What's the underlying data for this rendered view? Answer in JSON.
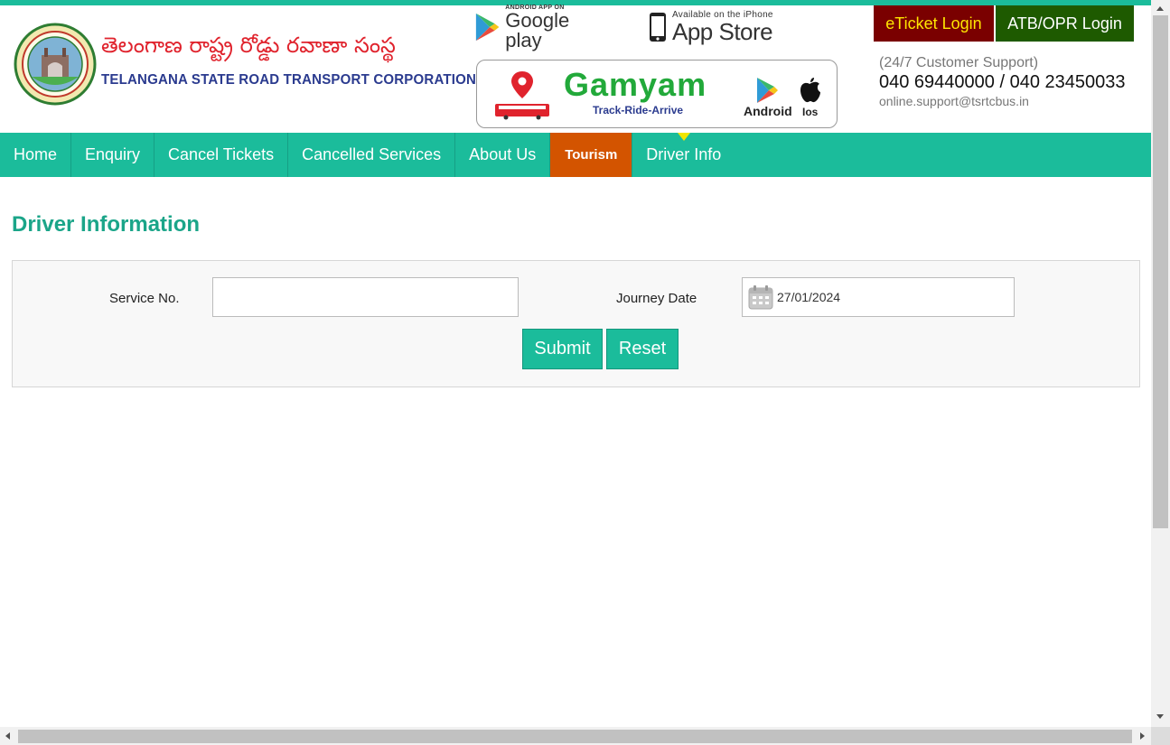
{
  "header": {
    "brand_telugu": "తెలంగాణ  రాష్ట్ర రోడ్డు రవాణా సంస్థ",
    "brand_english": "TELANGANA STATE ROAD TRANSPORT CORPORATION",
    "google_play": {
      "small": "ANDROID APP ON",
      "big": "Google play"
    },
    "app_store": {
      "small": "Available on the iPhone",
      "big": "App Store"
    },
    "gamyam": {
      "title": "Gamyam",
      "tagline": "Track-Ride-Arrive",
      "android": "Android",
      "ios": "Ios"
    },
    "eticket_login": "eTicket Login",
    "atb_login": "ATB/OPR Login",
    "support_label": "(24/7 Customer Support)",
    "support_phones": "040 69440000 / 040 23450033",
    "support_email": "online.support@tsrtcbus.in"
  },
  "nav": {
    "items": [
      {
        "label": "Home"
      },
      {
        "label": "Enquiry"
      },
      {
        "label": "Cancel Tickets"
      },
      {
        "label": "Cancelled Services"
      },
      {
        "label": "About Us"
      },
      {
        "label": "Tourism"
      },
      {
        "label": "Driver Info"
      }
    ]
  },
  "main": {
    "title": "Driver Information",
    "service_label": "Service No.",
    "service_value": "",
    "date_label": "Journey Date",
    "date_value": "27/01/2024",
    "submit_label": "Submit",
    "reset_label": "Reset"
  },
  "colors": {
    "accent": "#1bbc9b",
    "tourism": "#d35400",
    "eticket_bg": "#7a0000",
    "atb_bg": "#1e5a00"
  }
}
